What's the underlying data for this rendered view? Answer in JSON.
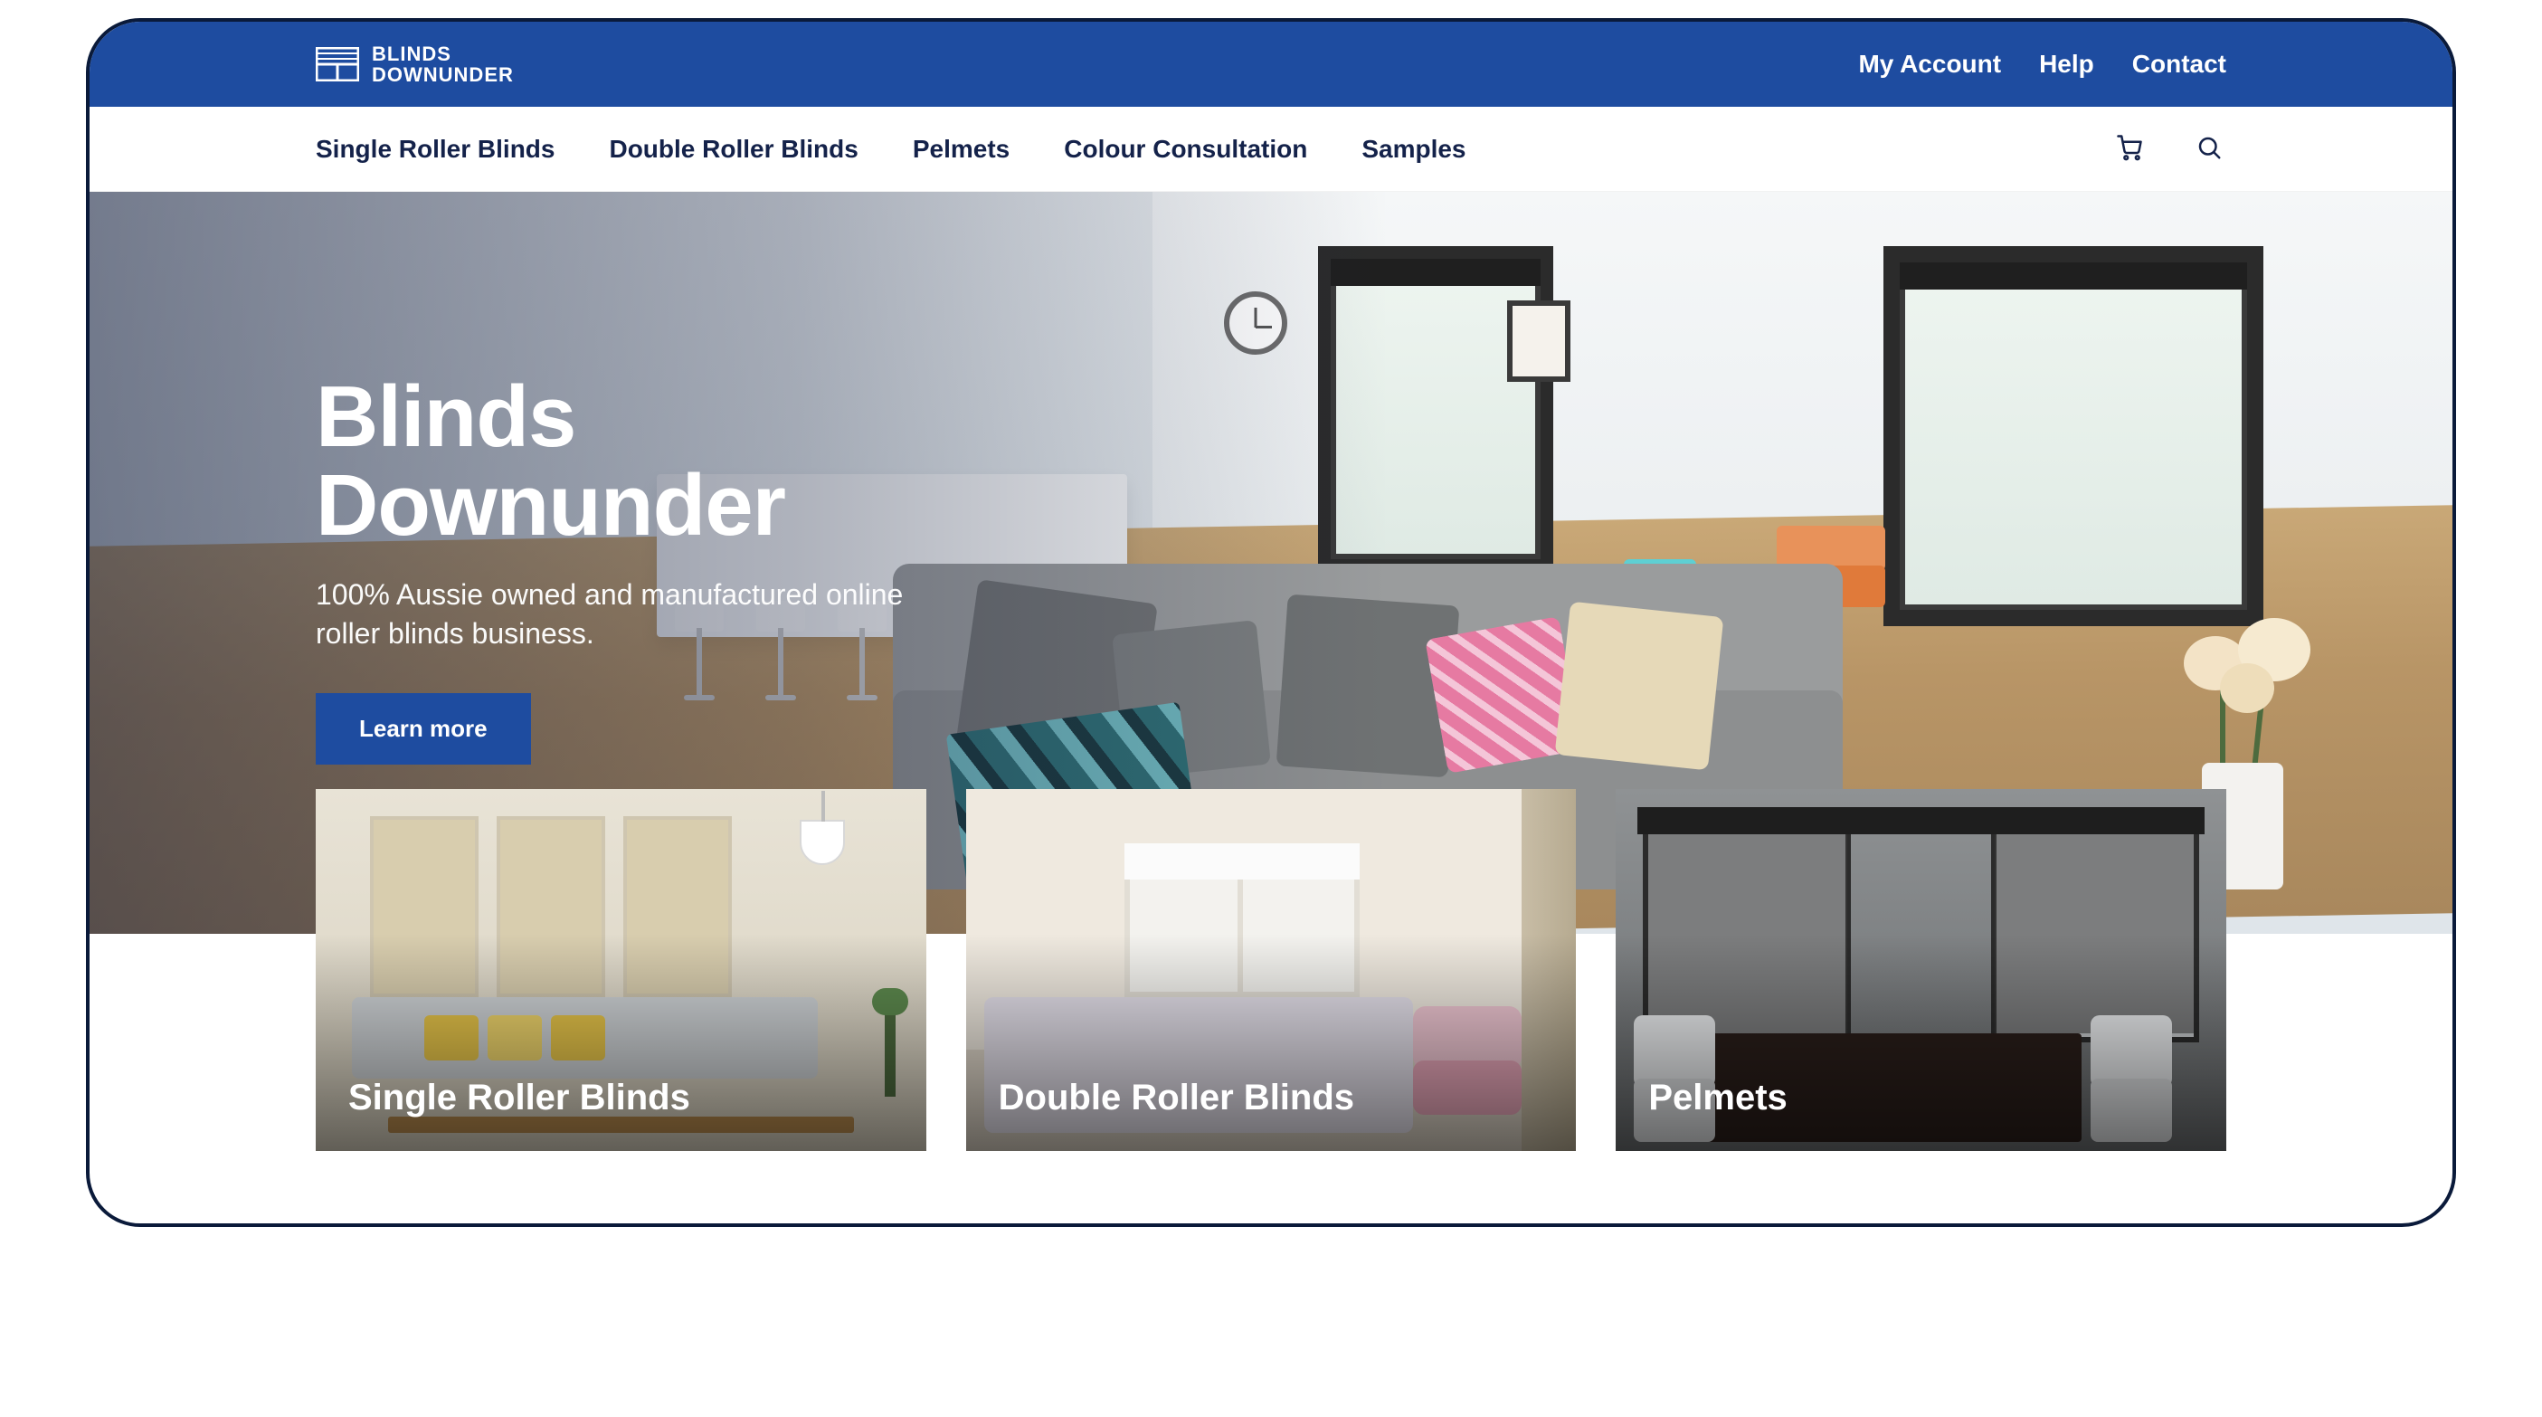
{
  "brand": {
    "line1": "BLINDS",
    "line2": "DOWNUNDER"
  },
  "top_links": {
    "account": "My Account",
    "help": "Help",
    "contact": "Contact"
  },
  "nav": {
    "items": [
      "Single Roller Blinds",
      "Double Roller Blinds",
      "Pelmets",
      "Colour Consultation",
      "Samples"
    ],
    "cart_icon": "cart-icon",
    "search_icon": "search-icon"
  },
  "hero": {
    "title_line1": "Blinds",
    "title_line2": "Downunder",
    "subtitle": "100% Aussie owned and manufactured online roller blinds business.",
    "cta": "Learn more"
  },
  "cards": [
    {
      "title": "Single Roller Blinds"
    },
    {
      "title": "Double Roller Blinds"
    },
    {
      "title": "Pelmets"
    }
  ],
  "colors": {
    "brand_blue": "#1e4ca0",
    "navy_text": "#14224a"
  }
}
